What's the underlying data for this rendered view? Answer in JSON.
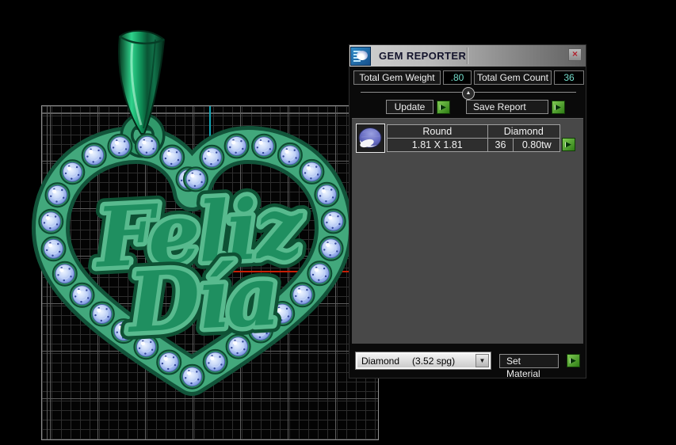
{
  "panel": {
    "title": "GEM REPORTER",
    "icons": {
      "close": "×",
      "play": "▶",
      "collapse": "▲",
      "dropdown_arrow": "▼"
    },
    "totals": {
      "weight_label": "Total Gem Weight",
      "weight_value": ".80",
      "count_label": "Total Gem Count",
      "count_value": "36"
    },
    "buttons": {
      "update": "Update",
      "save_report": "Save Report",
      "set_material": "Set Material"
    },
    "gem_table": {
      "headers": [
        "Round",
        "Diamond"
      ],
      "row": {
        "size": "1.81 X 1.81",
        "count": "36",
        "weight": "0.80tw"
      }
    },
    "material_dropdown": {
      "name": "Diamond",
      "spg": "(3.52 spg)"
    },
    "accent_green": "#3f9c2a",
    "value_text_color": "#74dcca"
  },
  "viewport": {
    "pendant_text_line1": "Feliz",
    "pendant_text_line2": "Día",
    "axis_colors": {
      "vertical": "#12a4b4",
      "horizontal": "#c61f05"
    },
    "metal_color": "#42a87c",
    "gem_color": "#b9cdf4",
    "gem_count_on_band": 31
  }
}
